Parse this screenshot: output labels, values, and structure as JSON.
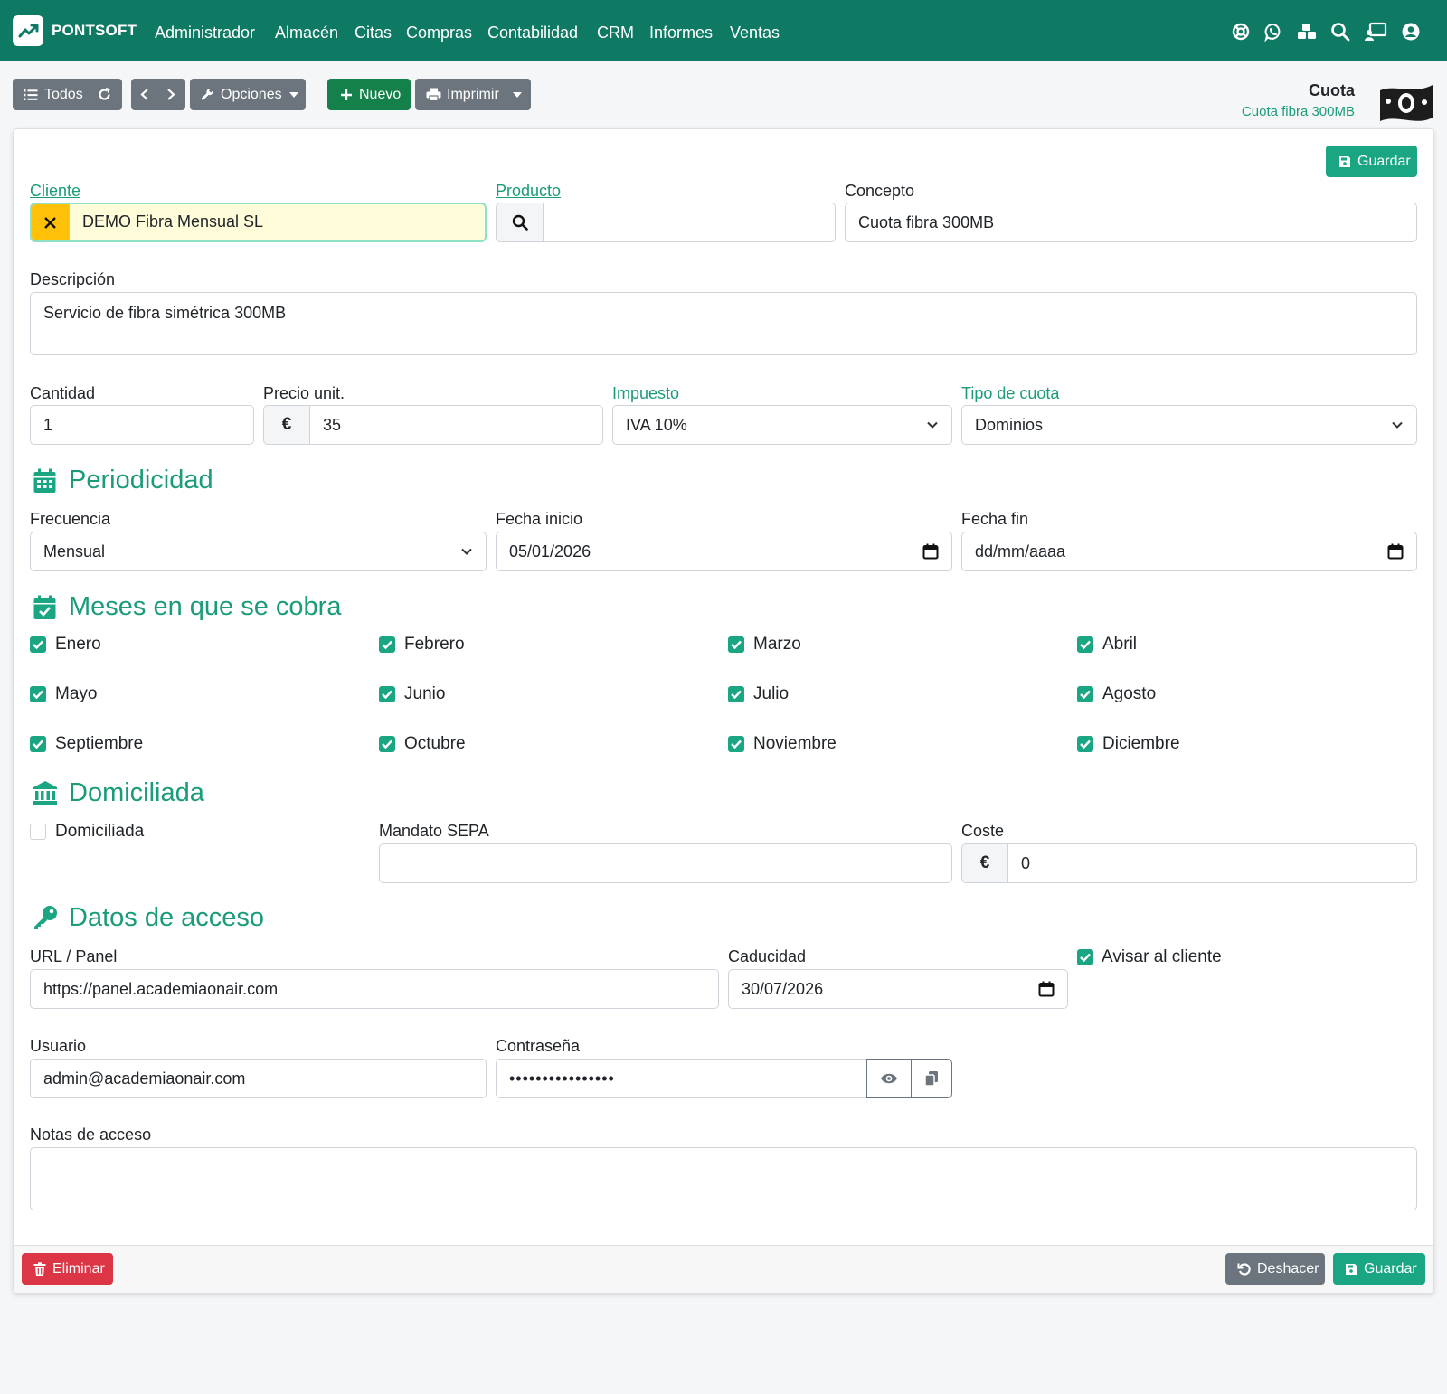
{
  "brand": {
    "name": "PONTSOFT"
  },
  "nav": {
    "items": [
      "Administrador",
      "Almacén",
      "Citas",
      "Compras",
      "Contabilidad",
      "CRM",
      "Informes",
      "Ventas"
    ],
    "icons": [
      "support-icon",
      "whatsapp-icon",
      "modules-icon",
      "search-icon",
      "screen-user-icon",
      "user-icon"
    ]
  },
  "toolbar": {
    "todos_label": "Todos",
    "opciones_label": "Opciones",
    "nuevo_label": "Nuevo",
    "imprimir_label": "Imprimir"
  },
  "header": {
    "title": "Cuota",
    "subtitle": "Cuota fibra 300MB"
  },
  "form": {
    "save_top_label": "Guardar",
    "cliente": {
      "label": "Cliente",
      "value": "DEMO Fibra Mensual SL"
    },
    "producto": {
      "label": "Producto",
      "value": ""
    },
    "concepto": {
      "label": "Concepto",
      "value": "Cuota fibra 300MB"
    },
    "descripcion": {
      "label": "Descripción",
      "value": "Servicio de fibra simétrica 300MB"
    },
    "cantidad": {
      "label": "Cantidad",
      "value": "1"
    },
    "precio": {
      "label": "Precio unit.",
      "currency": "€",
      "value": "35"
    },
    "impuesto": {
      "label": "Impuesto",
      "value": "IVA 10%"
    },
    "tipo_cuota": {
      "label": "Tipo de cuota",
      "value": "Dominios"
    }
  },
  "periodicidad": {
    "title": "Periodicidad",
    "frecuencia": {
      "label": "Frecuencia",
      "value": "Mensual"
    },
    "fecha_inicio": {
      "label": "Fecha inicio",
      "value": "05/01/2026"
    },
    "fecha_fin": {
      "label": "Fecha fin",
      "value": "dd/mm/aaaa"
    }
  },
  "meses": {
    "title": "Meses en que se cobra",
    "items": [
      {
        "label": "Enero",
        "checked": true
      },
      {
        "label": "Febrero",
        "checked": true
      },
      {
        "label": "Marzo",
        "checked": true
      },
      {
        "label": "Abril",
        "checked": true
      },
      {
        "label": "Mayo",
        "checked": true
      },
      {
        "label": "Junio",
        "checked": true
      },
      {
        "label": "Julio",
        "checked": true
      },
      {
        "label": "Agosto",
        "checked": true
      },
      {
        "label": "Septiembre",
        "checked": true
      },
      {
        "label": "Octubre",
        "checked": true
      },
      {
        "label": "Noviembre",
        "checked": true
      },
      {
        "label": "Diciembre",
        "checked": true
      }
    ]
  },
  "domiciliada": {
    "title": "Domiciliada",
    "check_label": "Domiciliada",
    "checked": false,
    "mandato": {
      "label": "Mandato SEPA",
      "value": ""
    },
    "coste": {
      "label": "Coste",
      "currency": "€",
      "value": "0"
    }
  },
  "acceso": {
    "title": "Datos de acceso",
    "url": {
      "label": "URL / Panel",
      "value": "https://panel.academiaonair.com"
    },
    "caducidad": {
      "label": "Caducidad",
      "value": "30/07/2026"
    },
    "avisar": {
      "label": "Avisar al cliente",
      "checked": true
    },
    "usuario": {
      "label": "Usuario",
      "value": "admin@academiaonair.com"
    },
    "password": {
      "label": "Contraseña",
      "value": "••••••••••••••••"
    },
    "notas": {
      "label": "Notas de acceso",
      "value": ""
    }
  },
  "footer": {
    "eliminar_label": "Eliminar",
    "deshacer_label": "Deshacer",
    "guardar_label": "Guardar"
  },
  "colors": {
    "navbar": "#0e7a64",
    "accent": "#1aa583",
    "danger": "#dc3545",
    "secondary": "#6c757d"
  }
}
